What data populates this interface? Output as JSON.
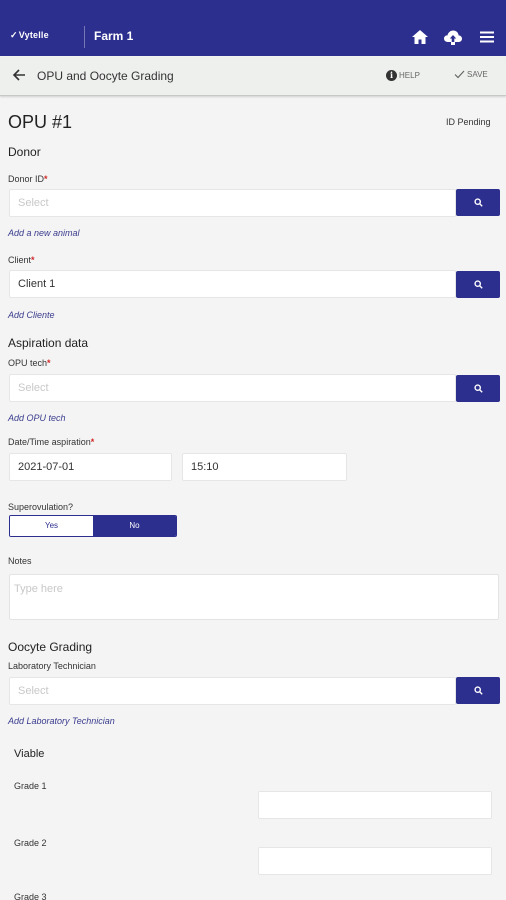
{
  "appbar": {
    "brand": "Vytelle",
    "farm": "Farm 1",
    "icons": [
      "home-icon",
      "cloud-upload-icon",
      "menu-icon"
    ],
    "color": "#2d2f8e"
  },
  "subbar": {
    "title": "OPU and Oocyte Grading",
    "help_label": "HELP",
    "save_label": "SAVE"
  },
  "page": {
    "title": "OPU #1",
    "status": "ID Pending"
  },
  "donor": {
    "section": "Donor",
    "donor_id_label": "Donor ID",
    "donor_id_placeholder": "Select",
    "add_animal": "Add a new animal",
    "client_label": "Client",
    "client_value": "Client 1",
    "add_client": "Add Cliente"
  },
  "aspiration": {
    "section": "Aspiration data",
    "opu_tech_label": "OPU tech",
    "opu_tech_placeholder": "Select",
    "add_opu_tech": "Add OPU tech",
    "datetime_label": "Date/Time aspiration",
    "date_value": "2021-07-01",
    "time_value": "15:10",
    "superovulation_label": "Superovulation?",
    "yes_label": "Yes",
    "no_label": "No",
    "selected": "No",
    "notes_label": "Notes",
    "notes_placeholder": "Type here"
  },
  "oocyte": {
    "section": "Oocyte Grading",
    "lab_tech_label": "Laboratory Technician",
    "lab_tech_placeholder": "Select",
    "add_lab_tech": "Add Laboratory Technician",
    "viable_label": "Viable",
    "grades": [
      "Grade 1",
      "Grade 2",
      "Grade 3"
    ]
  },
  "required_mark": "*"
}
